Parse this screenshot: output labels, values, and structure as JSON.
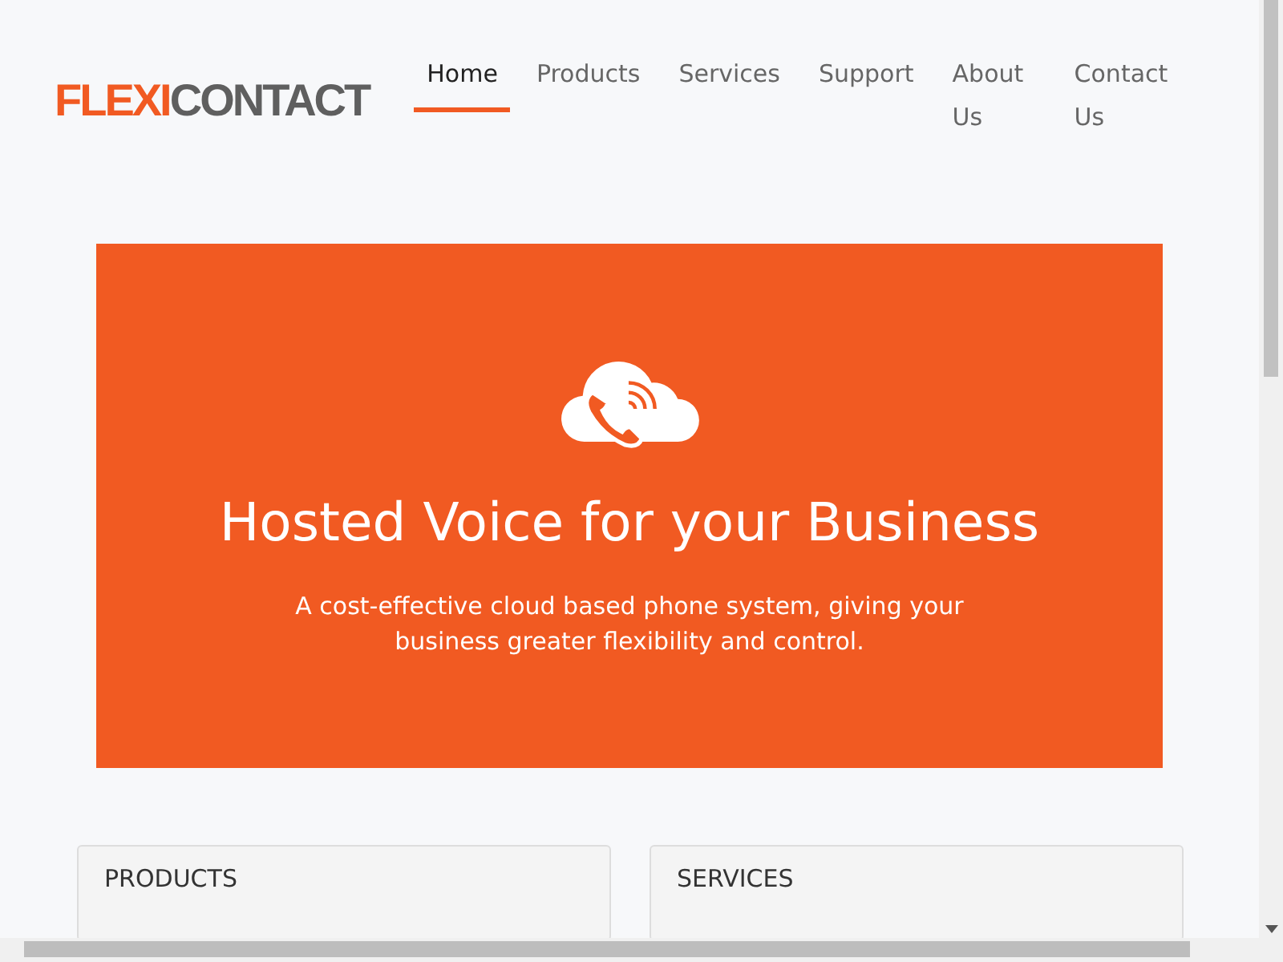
{
  "logo": {
    "parts": [
      {
        "text": "FLEXI",
        "color": "#f15a22"
      },
      {
        "text": "CONTACT",
        "color": "#5f5f5f"
      }
    ]
  },
  "nav": [
    {
      "label": "Home",
      "selected": true
    },
    {
      "label": "Products",
      "selected": false
    },
    {
      "label": "Services",
      "selected": false
    },
    {
      "label": "Support",
      "selected": false
    },
    {
      "label": "About Us",
      "selected": false
    },
    {
      "label": "Contact Us",
      "selected": false
    }
  ],
  "hero": {
    "title": "Hosted Voice for your Business",
    "subtitle": "A cost-effective cloud based phone system, giving your business greater flexibility and control."
  },
  "cards": [
    {
      "title": "PRODUCTS"
    },
    {
      "title": "SERVICES"
    }
  ]
}
